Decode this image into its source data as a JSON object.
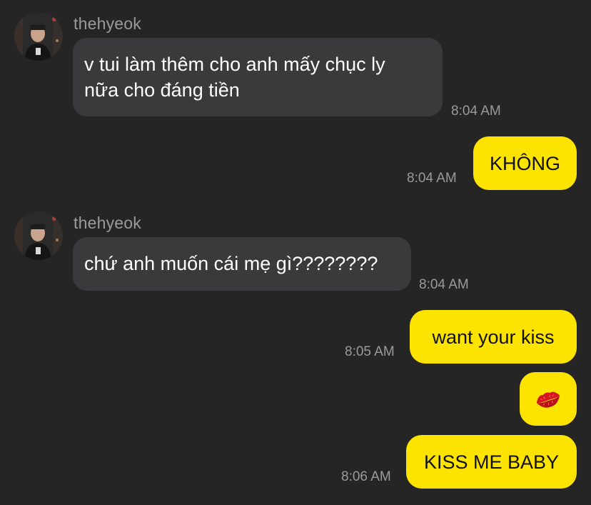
{
  "chat": {
    "messages": [
      {
        "sender": "thehyeok",
        "direction": "in",
        "lines": [
          "v tui làm thêm cho anh mấy chục ly",
          "nữa cho đáng tiền"
        ],
        "time": "8:04 AM"
      },
      {
        "direction": "out",
        "text": "KHÔNG",
        "time": "8:04 AM"
      },
      {
        "sender": "thehyeok",
        "direction": "in",
        "lines": [
          "chứ anh muốn cái mẹ gì????????"
        ],
        "time": "8:04 AM"
      },
      {
        "direction": "out",
        "text": "want your kiss",
        "time": "8:05 AM"
      },
      {
        "direction": "out",
        "sticker": "💋",
        "icon": "lips-kiss-icon"
      },
      {
        "direction": "out",
        "text": "KISS ME BABY",
        "time": "8:06 AM"
      }
    ]
  },
  "colors": {
    "background": "#252525",
    "incoming_bubble": "#3a3a3c",
    "outgoing_bubble": "#fde300",
    "timestamp": "#9a9a9a"
  }
}
